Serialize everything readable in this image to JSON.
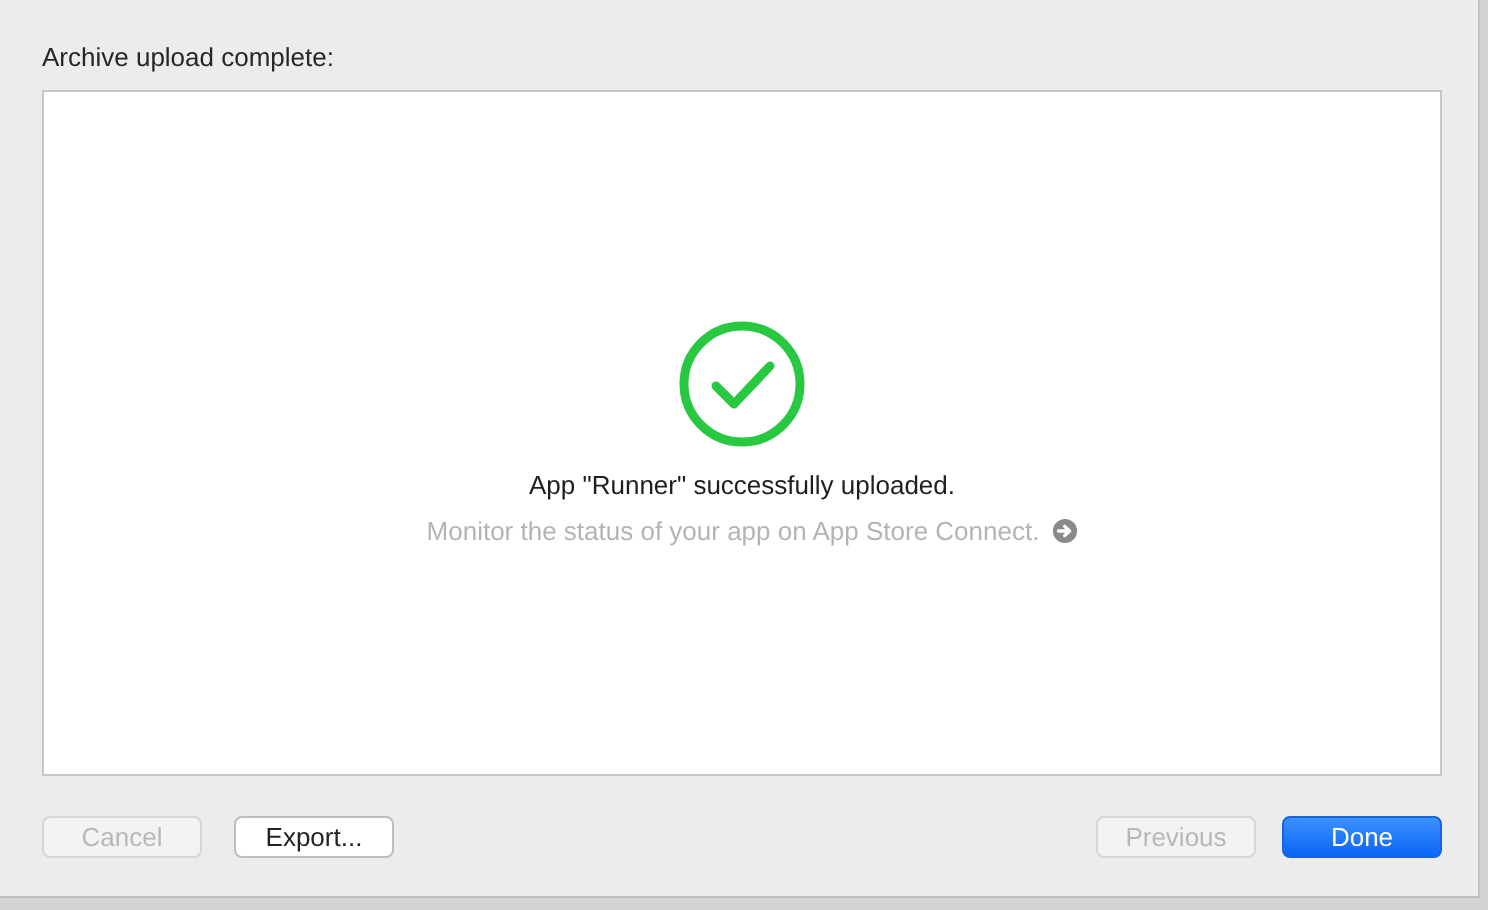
{
  "sheet": {
    "title": "Archive upload complete:"
  },
  "result": {
    "message": "App \"Runner\" successfully uploaded.",
    "link": "Monitor the status of your app on App Store Connect."
  },
  "buttons_left": [
    {
      "label": "Cancel",
      "disabled": true,
      "kind": "plain"
    },
    {
      "label": "Export...",
      "disabled": false,
      "kind": "plain"
    }
  ],
  "buttons_right": [
    {
      "label": "Previous",
      "disabled": true,
      "kind": "plain"
    },
    {
      "label": "Done",
      "disabled": false,
      "kind": "primary"
    }
  ]
}
